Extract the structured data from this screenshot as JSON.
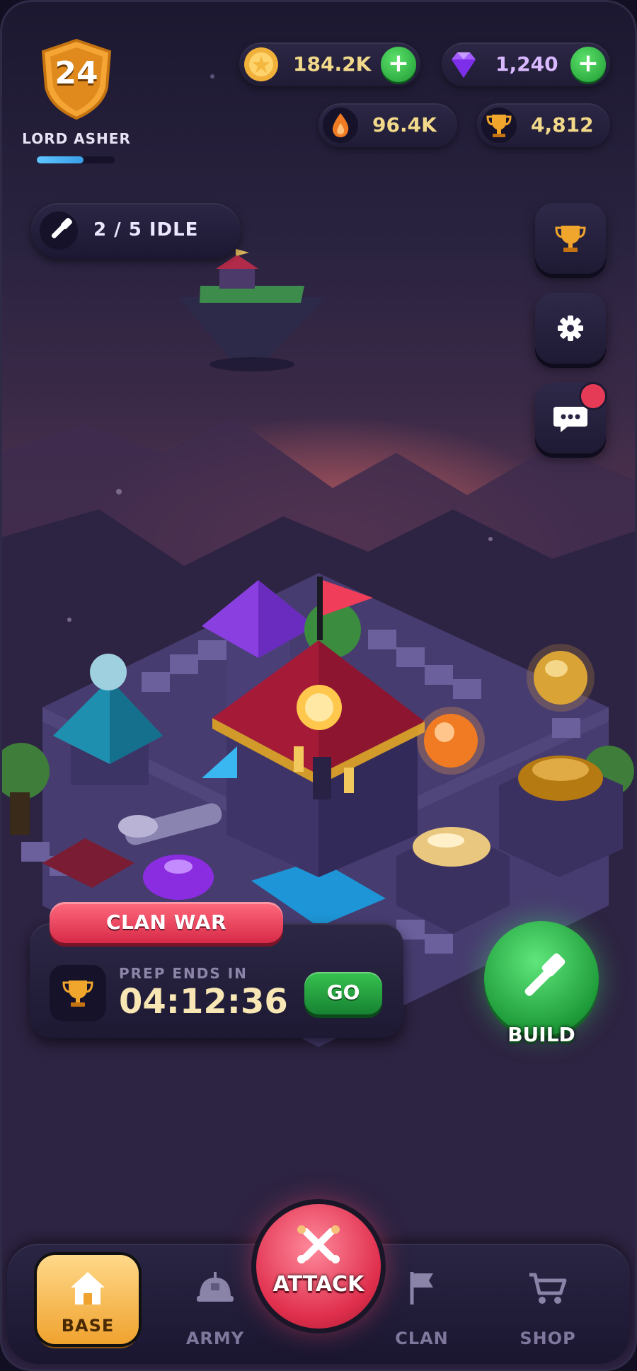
{
  "player": {
    "level": "24",
    "name": "LORD ASHER",
    "xp_progress": 0.6
  },
  "resources": [
    {
      "id": "gold",
      "icon": "gold-coin-icon",
      "value": "184.2K",
      "has_plus": true
    },
    {
      "id": "gems",
      "icon": "gem-icon",
      "value": "1,240",
      "has_plus": true
    },
    {
      "id": "elixir",
      "icon": "flame-drop-icon",
      "value": "96.4K",
      "has_plus": false
    },
    {
      "id": "trophies",
      "icon": "trophy-icon",
      "value": "4,812",
      "has_plus": false
    }
  ],
  "builders": {
    "label": "2 / 5 IDLE",
    "icon": "hammer-icon"
  },
  "side_buttons": [
    {
      "id": "leaderboard",
      "icon": "trophy-icon"
    },
    {
      "id": "settings",
      "icon": "gear-icon"
    },
    {
      "id": "chat",
      "icon": "chat-bubble-icon",
      "notification": true
    }
  ],
  "clan_war": {
    "tag": "CLAN WAR",
    "label": "PREP ENDS IN",
    "timer": "04:12:36",
    "go_label": "GO"
  },
  "build_button": {
    "label": "BUILD"
  },
  "nav": {
    "base": "BASE",
    "army": "ARMY",
    "attack": "ATTACK",
    "clan": "CLAN",
    "shop": "SHOP"
  },
  "colors": {
    "gold": "#f2d98a",
    "green": "#2fb24a",
    "red": "#e0304e",
    "panel": "#241f3b"
  }
}
